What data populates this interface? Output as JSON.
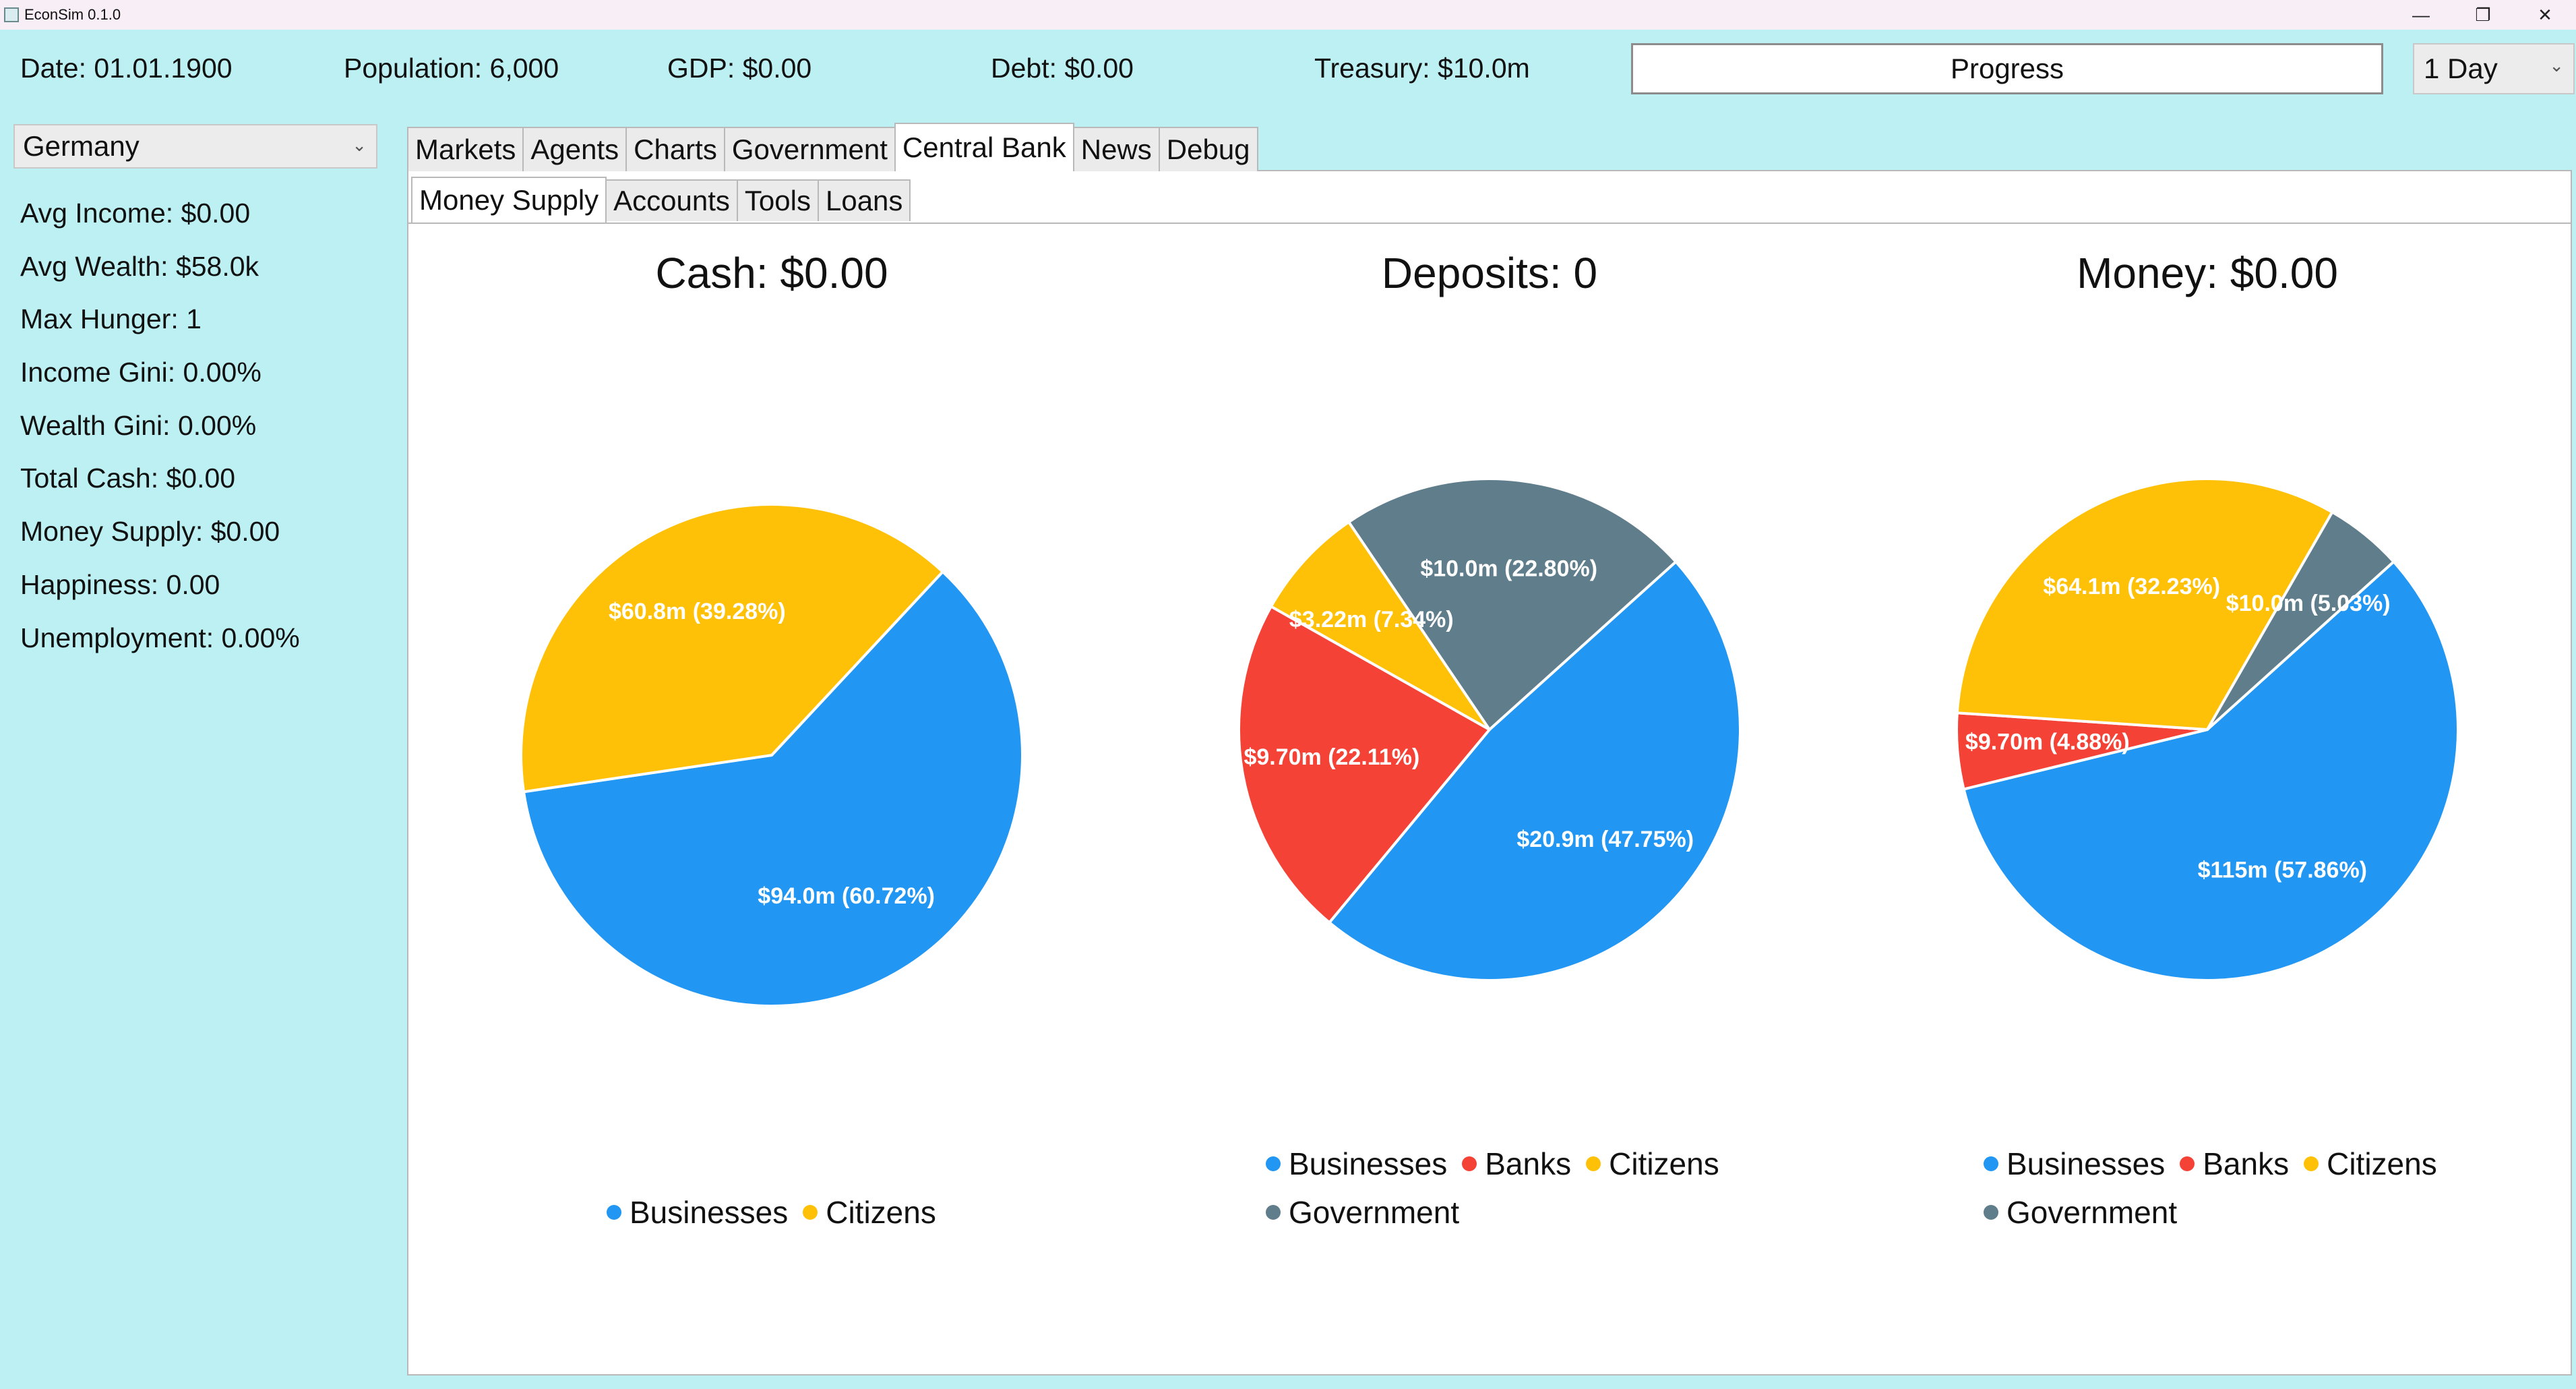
{
  "window": {
    "title": "EconSim 0.1.0",
    "buttons": [
      "—",
      "❐",
      "✕"
    ]
  },
  "status": {
    "date": "Date: 01.01.1900",
    "population": "Population: 6,000",
    "gdp": "GDP: $0.00",
    "debt": "Debt: $0.00",
    "treasury": "Treasury: $10.0m",
    "progress_label": "Progress",
    "speed": "1 Day"
  },
  "sidebar": {
    "country": "Germany",
    "stats": [
      "Avg Income: $0.00",
      "Avg Wealth: $58.0k",
      "Max Hunger: 1",
      "Income Gini: 0.00%",
      "Wealth Gini: 0.00%",
      "Total Cash: $0.00",
      "Money Supply: $0.00",
      "Happiness: 0.00",
      "Unemployment: 0.00%"
    ]
  },
  "tabs": [
    "Markets",
    "Agents",
    "Charts",
    "Government",
    "Central Bank",
    "News",
    "Debug"
  ],
  "active_tab": "Central Bank",
  "sub_tabs": [
    "Money Supply",
    "Accounts",
    "Tools",
    "Loans"
  ],
  "active_sub_tab": "Money Supply",
  "colors": {
    "Businesses": "#2196f3",
    "Banks": "#f44336",
    "Citizens": "#ffc107",
    "Government": "#607d8b"
  },
  "chart_data": [
    {
      "type": "pie",
      "title": "Cash: $0.00",
      "slices": [
        {
          "name": "Businesses",
          "value": 94.0,
          "label": "$94.0m (60.72%)"
        },
        {
          "name": "Citizens",
          "value": 60.8,
          "label": "$60.8m (39.28%)"
        }
      ],
      "legend": [
        [
          "Businesses",
          "Citizens"
        ]
      ]
    },
    {
      "type": "pie",
      "title": "Deposits: 0",
      "slices": [
        {
          "name": "Businesses",
          "value": 20.9,
          "label": "$20.9m (47.75%)"
        },
        {
          "name": "Banks",
          "value": 9.7,
          "label": "$9.70m (22.11%)"
        },
        {
          "name": "Citizens",
          "value": 3.22,
          "label": "$3.22m (7.34%)"
        },
        {
          "name": "Government",
          "value": 10.0,
          "label": "$10.0m (22.80%)"
        }
      ],
      "legend": [
        [
          "Businesses",
          "Banks",
          "Citizens"
        ],
        [
          "Government"
        ]
      ]
    },
    {
      "type": "pie",
      "title": "Money: $0.00",
      "slices": [
        {
          "name": "Businesses",
          "value": 115,
          "label": "$115m (57.86%)"
        },
        {
          "name": "Banks",
          "value": 9.7,
          "label": "$9.70m (4.88%)"
        },
        {
          "name": "Citizens",
          "value": 64.1,
          "label": "$64.1m (32.23%)"
        },
        {
          "name": "Government",
          "value": 10.0,
          "label": "$10.0m (5.03%)"
        }
      ],
      "legend": [
        [
          "Businesses",
          "Banks",
          "Citizens"
        ],
        [
          "Government"
        ]
      ]
    }
  ]
}
